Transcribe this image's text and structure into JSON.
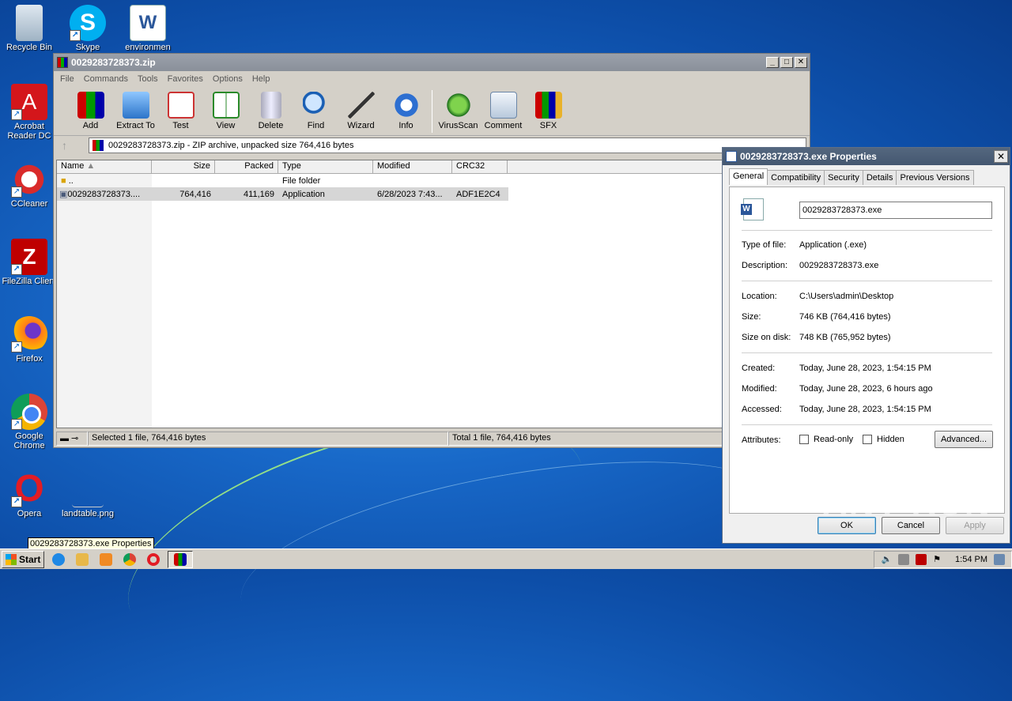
{
  "desktop": {
    "icons": [
      {
        "label": "Recycle Bin"
      },
      {
        "label": "Skype"
      },
      {
        "label": "environmen"
      },
      {
        "label": "Acrobat Reader DC"
      },
      {
        "label": "CCleaner"
      },
      {
        "label": "FileZilla Client"
      },
      {
        "label": "Firefox"
      },
      {
        "label": "Google Chrome"
      },
      {
        "label": "Opera"
      },
      {
        "label": "landtable.png"
      }
    ]
  },
  "winrar": {
    "title": "0029283728373.zip",
    "menu": [
      "File",
      "Commands",
      "Tools",
      "Favorites",
      "Options",
      "Help"
    ],
    "toolbar": [
      "Add",
      "Extract To",
      "Test",
      "View",
      "Delete",
      "Find",
      "Wizard",
      "Info",
      "VirusScan",
      "Comment",
      "SFX"
    ],
    "address": "0029283728373.zip - ZIP archive, unpacked size 764,416 bytes",
    "columns": [
      "Name",
      "Size",
      "Packed",
      "Type",
      "Modified",
      "CRC32"
    ],
    "rows": [
      {
        "name": "..",
        "size": "",
        "packed": "",
        "type": "File folder",
        "modified": "",
        "crc": ""
      },
      {
        "name": "0029283728373....",
        "size": "764,416",
        "packed": "411,169",
        "type": "Application",
        "modified": "6/28/2023 7:43...",
        "crc": "ADF1E2C4"
      }
    ],
    "status_left": "Selected 1 file, 764,416 bytes",
    "status_right": "Total 1 file, 764,416 bytes"
  },
  "props": {
    "title": "0029283728373.exe Properties",
    "tabs": [
      "General",
      "Compatibility",
      "Security",
      "Details",
      "Previous Versions"
    ],
    "filename": "0029283728373.exe",
    "type_label": "Type of file:",
    "type_value": "Application (.exe)",
    "desc_label": "Description:",
    "desc_value": "0029283728373.exe",
    "loc_label": "Location:",
    "loc_value": "C:\\Users\\admin\\Desktop",
    "size_label": "Size:",
    "size_value": "746 KB (764,416 bytes)",
    "disk_label": "Size on disk:",
    "disk_value": "748 KB (765,952 bytes)",
    "created_label": "Created:",
    "created_value": "Today, June 28, 2023, 1:54:15 PM",
    "modified_label": "Modified:",
    "modified_value": "Today, June 28, 2023, 6 hours ago",
    "accessed_label": "Accessed:",
    "accessed_value": "Today, June 28, 2023, 1:54:15 PM",
    "attr_label": "Attributes:",
    "readonly": "Read-only",
    "hidden": "Hidden",
    "advanced": "Advanced...",
    "ok": "OK",
    "cancel": "Cancel",
    "apply": "Apply"
  },
  "watermark": "ANY RUN",
  "tooltip": "0029283728373.exe Properties",
  "taskbar": {
    "start": "Start",
    "clock": "1:54 PM"
  }
}
